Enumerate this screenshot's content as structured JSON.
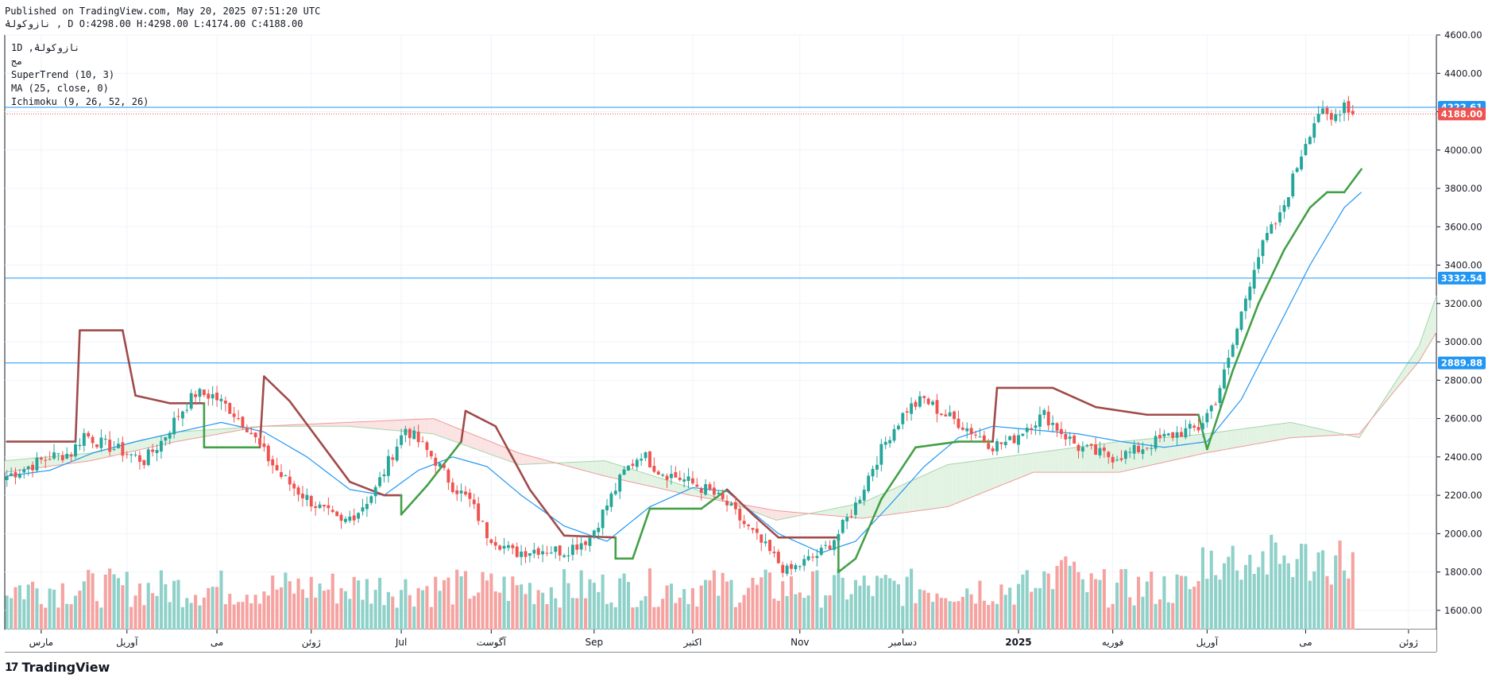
{
  "header": {
    "published": "Published on TradingView.com, May 20, 2025 07:51:20 UTC",
    "ohlc_line": "نازوکولۀ , D O:4298.00 H:4298.00 L:4174.00 C:4188.00"
  },
  "legend": {
    "items": [
      "1D ,نازوکولۀ",
      "مج",
      "SuperTrend (10, 3)",
      "MA (25, close, 0)",
      "Ichimoku (9, 26, 52, 26)"
    ]
  },
  "brand": {
    "name": "TradingView",
    "mark": "17"
  },
  "colors": {
    "up": "#26a69a",
    "down": "#ef5350",
    "up_vol": "#8fd1c9",
    "down_vol": "#f5a3a1",
    "supertrend_up": "#43a047",
    "supertrend_down": "#a14a4a",
    "ma": "#2196f3",
    "hline": "#2196f3",
    "cloud_red": "#fbe3e3",
    "cloud_green": "#e3f3e3",
    "last": "#ef5350"
  },
  "chart_data": {
    "type": "candlestick",
    "ylim": [
      1500,
      4600
    ],
    "y_ticks": [
      1600,
      1800,
      2000,
      2200,
      2400,
      2600,
      2800,
      3000,
      3200,
      3400,
      3600,
      3800,
      4000,
      4200,
      4400,
      4600
    ],
    "x_labels": [
      {
        "label": "مارس",
        "index": 8
      },
      {
        "label": "آوریل",
        "index": 28
      },
      {
        "label": "می",
        "index": 49
      },
      {
        "label": "ژوئن",
        "index": 71
      },
      {
        "label": "Jul",
        "index": 92
      },
      {
        "label": "آگوست",
        "index": 113
      },
      {
        "label": "Sep",
        "index": 137
      },
      {
        "label": "اکتبر",
        "index": 160
      },
      {
        "label": "Nov",
        "index": 185
      },
      {
        "label": "دسامبر",
        "index": 209
      },
      {
        "label": "2025",
        "index": 236
      },
      {
        "label": "فوریه",
        "index": 258
      },
      {
        "label": "آوریل",
        "index": 280
      },
      {
        "label": "می",
        "index": 303
      },
      {
        "label": "ژوئن",
        "index": 327
      }
    ],
    "total_slots": 334,
    "horizontal_lines": [
      4222.61,
      3332.54,
      2889.88
    ],
    "price_labels": [
      {
        "value": 4222.61,
        "text": "4222.61",
        "color": "#2196f3"
      },
      {
        "value": 4188.0,
        "text": "4188.00",
        "color": "#ef5350"
      },
      {
        "value": 3332.54,
        "text": "3332.54",
        "color": "#2196f3"
      },
      {
        "value": 2889.88,
        "text": "2889.88",
        "color": "#2196f3"
      }
    ],
    "last_price": 4188.0,
    "close_anchors": [
      [
        0,
        2300
      ],
      [
        5,
        2350
      ],
      [
        10,
        2400
      ],
      [
        15,
        2420
      ],
      [
        18,
        2520
      ],
      [
        22,
        2470
      ],
      [
        28,
        2420
      ],
      [
        32,
        2380
      ],
      [
        36,
        2480
      ],
      [
        40,
        2620
      ],
      [
        44,
        2730
      ],
      [
        48,
        2720
      ],
      [
        52,
        2650
      ],
      [
        56,
        2560
      ],
      [
        60,
        2420
      ],
      [
        64,
        2300
      ],
      [
        68,
        2220
      ],
      [
        72,
        2150
      ],
      [
        78,
        2050
      ],
      [
        82,
        2120
      ],
      [
        86,
        2230
      ],
      [
        90,
        2420
      ],
      [
        93,
        2550
      ],
      [
        96,
        2480
      ],
      [
        100,
        2380
      ],
      [
        104,
        2250
      ],
      [
        108,
        2170
      ],
      [
        112,
        2000
      ],
      [
        118,
        1900
      ],
      [
        124,
        1920
      ],
      [
        130,
        1910
      ],
      [
        136,
        1980
      ],
      [
        140,
        2150
      ],
      [
        144,
        2320
      ],
      [
        148,
        2420
      ],
      [
        152,
        2330
      ],
      [
        158,
        2280
      ],
      [
        164,
        2220
      ],
      [
        168,
        2150
      ],
      [
        172,
        2050
      ],
      [
        178,
        1900
      ],
      [
        182,
        1800
      ],
      [
        186,
        1850
      ],
      [
        190,
        1900
      ],
      [
        194,
        2000
      ],
      [
        198,
        2150
      ],
      [
        202,
        2350
      ],
      [
        206,
        2520
      ],
      [
        210,
        2650
      ],
      [
        214,
        2700
      ],
      [
        218,
        2630
      ],
      [
        222,
        2580
      ],
      [
        226,
        2520
      ],
      [
        230,
        2460
      ],
      [
        234,
        2480
      ],
      [
        238,
        2560
      ],
      [
        242,
        2620
      ],
      [
        246,
        2530
      ],
      [
        250,
        2450
      ],
      [
        254,
        2420
      ],
      [
        258,
        2400
      ],
      [
        262,
        2420
      ],
      [
        266,
        2460
      ],
      [
        270,
        2500
      ],
      [
        274,
        2530
      ],
      [
        278,
        2550
      ],
      [
        282,
        2700
      ],
      [
        285,
        2900
      ],
      [
        288,
        3150
      ],
      [
        291,
        3400
      ],
      [
        294,
        3550
      ],
      [
        297,
        3650
      ],
      [
        300,
        3850
      ],
      [
        303,
        4050
      ],
      [
        306,
        4200
      ],
      [
        309,
        4150
      ],
      [
        312,
        4250
      ],
      [
        314,
        4188
      ]
    ],
    "supertrend_anchors": [
      [
        0,
        2480,
        "down"
      ],
      [
        16,
        2480,
        "down"
      ],
      [
        17,
        3060,
        "down"
      ],
      [
        27,
        3060,
        "down"
      ],
      [
        30,
        2720,
        "down"
      ],
      [
        38,
        2680,
        "down"
      ],
      [
        46,
        2680,
        "down"
      ],
      [
        46,
        2450,
        "up"
      ],
      [
        59,
        2450,
        "up"
      ],
      [
        60,
        2820,
        "down"
      ],
      [
        66,
        2690,
        "down"
      ],
      [
        72,
        2510,
        "down"
      ],
      [
        80,
        2270,
        "down"
      ],
      [
        88,
        2200,
        "down"
      ],
      [
        92,
        2200,
        "down"
      ],
      [
        92,
        2100,
        "up"
      ],
      [
        98,
        2250,
        "up"
      ],
      [
        106,
        2480,
        "up"
      ],
      [
        107,
        2640,
        "down"
      ],
      [
        114,
        2560,
        "down"
      ],
      [
        122,
        2230,
        "down"
      ],
      [
        130,
        1990,
        "down"
      ],
      [
        142,
        1980,
        "down"
      ],
      [
        142,
        1870,
        "up"
      ],
      [
        146,
        1870,
        "up"
      ],
      [
        150,
        2130,
        "up"
      ],
      [
        162,
        2130,
        "up"
      ],
      [
        168,
        2230,
        "up"
      ],
      [
        174,
        2100,
        "down"
      ],
      [
        180,
        1980,
        "down"
      ],
      [
        194,
        1980,
        "down"
      ],
      [
        194,
        1800,
        "up"
      ],
      [
        198,
        1870,
        "up"
      ],
      [
        204,
        2180,
        "up"
      ],
      [
        212,
        2450,
        "up"
      ],
      [
        222,
        2480,
        "up"
      ],
      [
        230,
        2480,
        "up"
      ],
      [
        231,
        2760,
        "down"
      ],
      [
        244,
        2760,
        "down"
      ],
      [
        254,
        2660,
        "down"
      ],
      [
        266,
        2620,
        "down"
      ],
      [
        278,
        2620,
        "down"
      ],
      [
        280,
        2440,
        "up"
      ],
      [
        286,
        2850,
        "up"
      ],
      [
        292,
        3200,
        "up"
      ],
      [
        298,
        3480,
        "up"
      ],
      [
        304,
        3700,
        "up"
      ],
      [
        308,
        3780,
        "up"
      ],
      [
        312,
        3780,
        "up"
      ],
      [
        316,
        3900,
        "up"
      ]
    ],
    "ma_anchors": [
      [
        0,
        2300
      ],
      [
        10,
        2330
      ],
      [
        20,
        2420
      ],
      [
        30,
        2480
      ],
      [
        40,
        2530
      ],
      [
        50,
        2580
      ],
      [
        60,
        2530
      ],
      [
        70,
        2400
      ],
      [
        80,
        2230
      ],
      [
        88,
        2200
      ],
      [
        96,
        2330
      ],
      [
        104,
        2400
      ],
      [
        112,
        2350
      ],
      [
        120,
        2200
      ],
      [
        130,
        2040
      ],
      [
        140,
        1960
      ],
      [
        150,
        2140
      ],
      [
        160,
        2240
      ],
      [
        168,
        2220
      ],
      [
        180,
        2000
      ],
      [
        190,
        1900
      ],
      [
        198,
        1960
      ],
      [
        206,
        2150
      ],
      [
        214,
        2350
      ],
      [
        222,
        2500
      ],
      [
        230,
        2560
      ],
      [
        240,
        2540
      ],
      [
        250,
        2520
      ],
      [
        260,
        2480
      ],
      [
        270,
        2450
      ],
      [
        280,
        2480
      ],
      [
        288,
        2700
      ],
      [
        296,
        3050
      ],
      [
        304,
        3400
      ],
      [
        312,
        3700
      ],
      [
        316,
        3780
      ]
    ],
    "cloud_a_anchors": [
      [
        0,
        2380
      ],
      [
        20,
        2420
      ],
      [
        40,
        2530
      ],
      [
        60,
        2560
      ],
      [
        80,
        2560
      ],
      [
        100,
        2520
      ],
      [
        120,
        2360
      ],
      [
        140,
        2380
      ],
      [
        160,
        2240
      ],
      [
        180,
        2070
      ],
      [
        200,
        2160
      ],
      [
        220,
        2360
      ],
      [
        240,
        2420
      ],
      [
        260,
        2480
      ],
      [
        280,
        2520
      ],
      [
        300,
        2580
      ],
      [
        316,
        2500
      ],
      [
        330,
        2980
      ],
      [
        334,
        3240
      ]
    ],
    "cloud_b_anchors": [
      [
        0,
        2320
      ],
      [
        20,
        2380
      ],
      [
        40,
        2480
      ],
      [
        60,
        2560
      ],
      [
        80,
        2580
      ],
      [
        100,
        2600
      ],
      [
        120,
        2420
      ],
      [
        140,
        2300
      ],
      [
        160,
        2200
      ],
      [
        180,
        2120
      ],
      [
        200,
        2080
      ],
      [
        220,
        2140
      ],
      [
        240,
        2320
      ],
      [
        260,
        2320
      ],
      [
        280,
        2420
      ],
      [
        300,
        2500
      ],
      [
        316,
        2520
      ],
      [
        330,
        2900
      ],
      [
        334,
        3050
      ]
    ],
    "volume_seed": 7
  }
}
